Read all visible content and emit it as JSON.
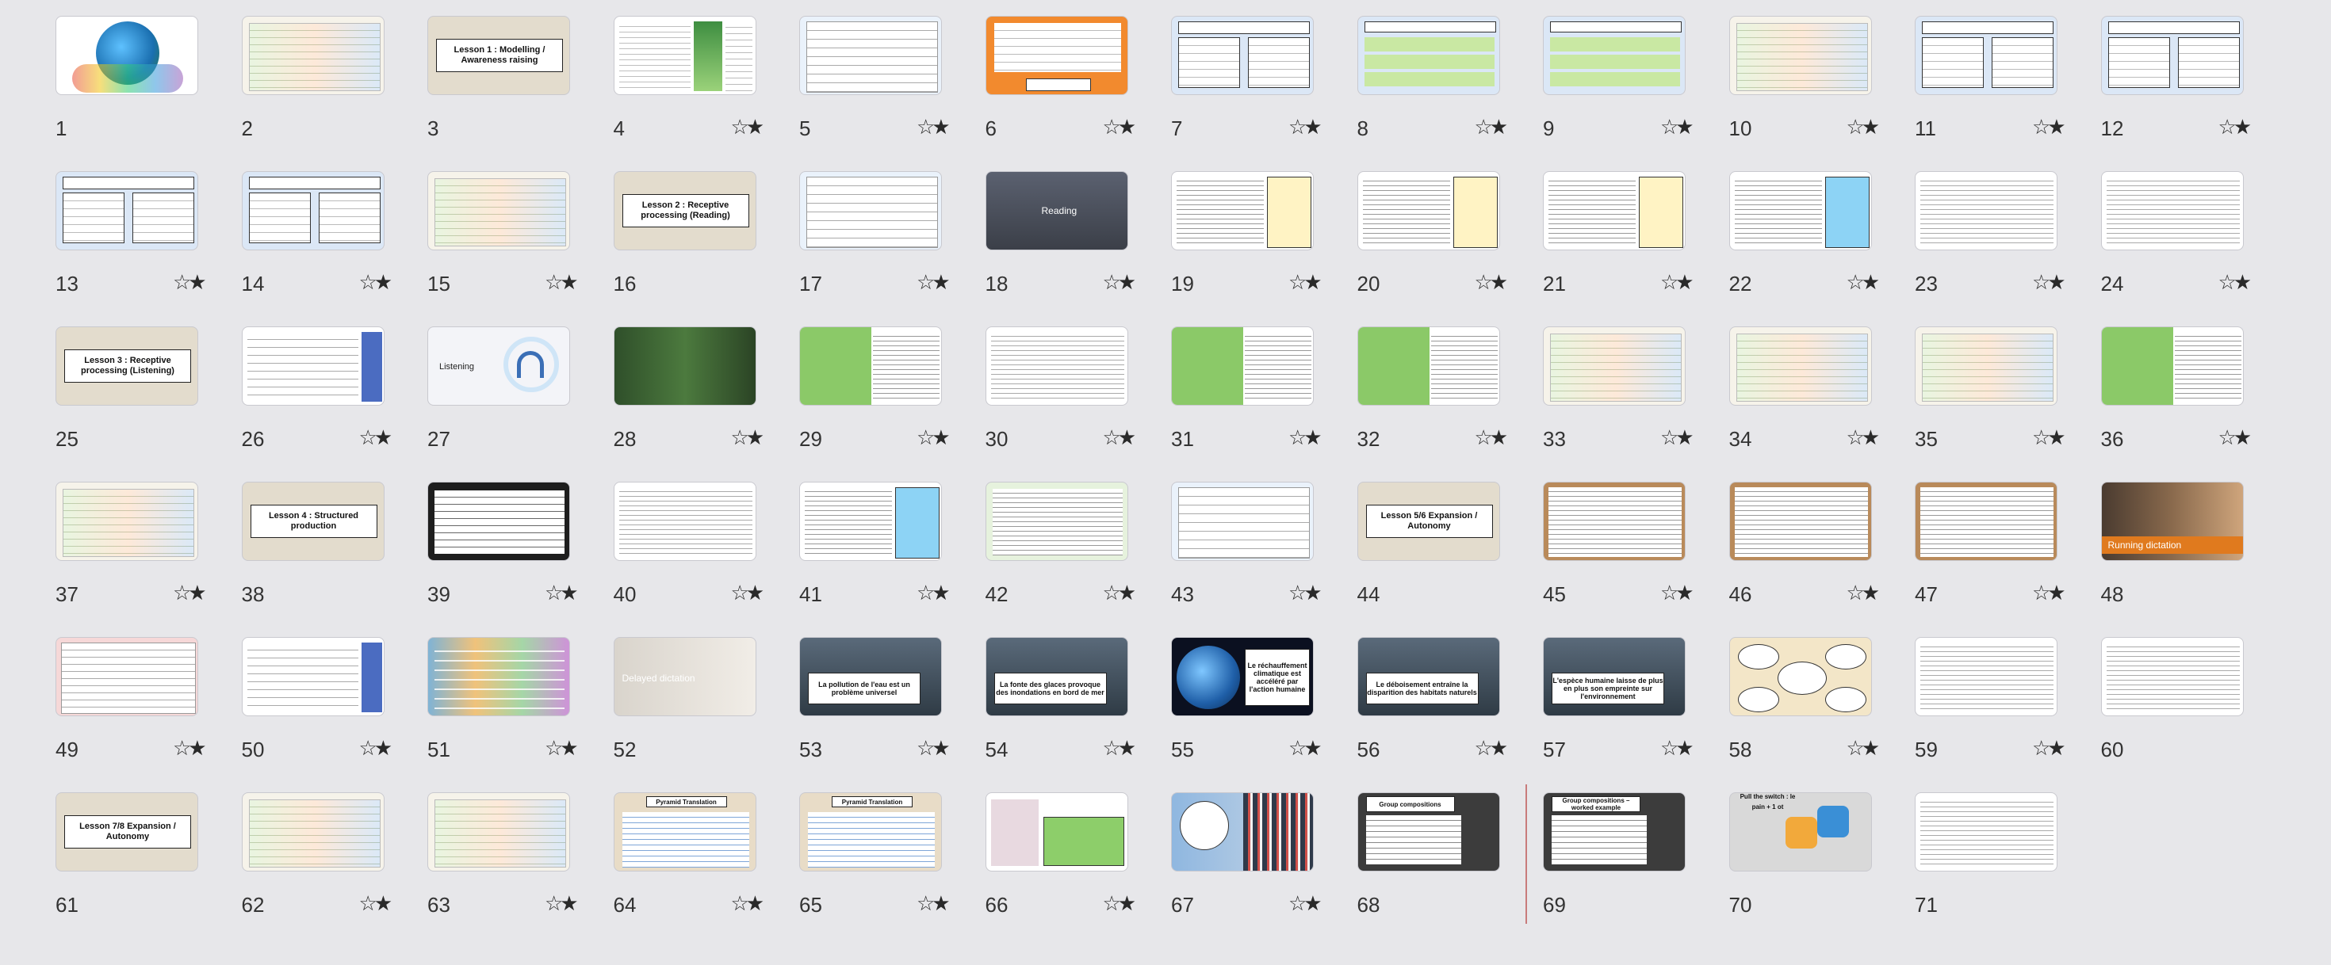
{
  "star_glyph": "☆★",
  "slides": [
    {
      "n": "1",
      "style": "globe"
    },
    {
      "n": "2",
      "style": "table"
    },
    {
      "n": "3",
      "style": "title-beige",
      "title": "Lesson 1 : Modelling / Awareness raising"
    },
    {
      "n": "4",
      "style": "list-img"
    },
    {
      "n": "5",
      "style": "list"
    },
    {
      "n": "6",
      "style": "orange"
    },
    {
      "n": "7",
      "style": "blue-q"
    },
    {
      "n": "8",
      "style": "green-q"
    },
    {
      "n": "9",
      "style": "green-q"
    },
    {
      "n": "10",
      "style": "table"
    },
    {
      "n": "11",
      "style": "blue-q"
    },
    {
      "n": "12",
      "style": "blue-q"
    },
    {
      "n": "13",
      "style": "blue-q"
    },
    {
      "n": "14",
      "style": "blue-q"
    },
    {
      "n": "15",
      "style": "table"
    },
    {
      "n": "16",
      "style": "title-beige",
      "title": "Lesson 2 : Receptive processing (Reading)"
    },
    {
      "n": "17",
      "style": "list"
    },
    {
      "n": "18",
      "style": "dark",
      "label": "Reading"
    },
    {
      "n": "19",
      "style": "text-yellow"
    },
    {
      "n": "20",
      "style": "text-yellow"
    },
    {
      "n": "21",
      "style": "text-yellow"
    },
    {
      "n": "22",
      "style": "text-blue"
    },
    {
      "n": "23",
      "style": "text"
    },
    {
      "n": "24",
      "style": "text"
    },
    {
      "n": "25",
      "style": "title-beige",
      "title": "Lesson 3 : Receptive processing (Listening)"
    },
    {
      "n": "26",
      "style": "list-blue"
    },
    {
      "n": "27",
      "style": "headphones",
      "label": "Listening"
    },
    {
      "n": "28",
      "style": "forest"
    },
    {
      "n": "29",
      "style": "green-text"
    },
    {
      "n": "30",
      "style": "text"
    },
    {
      "n": "31",
      "style": "green-text"
    },
    {
      "n": "32",
      "style": "green-text"
    },
    {
      "n": "33",
      "style": "table"
    },
    {
      "n": "34",
      "style": "table"
    },
    {
      "n": "35",
      "style": "table"
    },
    {
      "n": "36",
      "style": "green-text"
    },
    {
      "n": "37",
      "style": "table"
    },
    {
      "n": "38",
      "style": "title-beige",
      "title": "Lesson 4 : Structured production"
    },
    {
      "n": "39",
      "style": "dark-list"
    },
    {
      "n": "40",
      "style": "text"
    },
    {
      "n": "41",
      "style": "text-blue"
    },
    {
      "n": "42",
      "style": "text-green"
    },
    {
      "n": "43",
      "style": "list"
    },
    {
      "n": "44",
      "style": "title-beige",
      "title": "Lesson 5/6 Expansion / Autonomy"
    },
    {
      "n": "45",
      "style": "brown-text"
    },
    {
      "n": "46",
      "style": "brown-text"
    },
    {
      "n": "47",
      "style": "brown-text"
    },
    {
      "n": "48",
      "style": "running",
      "label": "Running dictation"
    },
    {
      "n": "49",
      "style": "red-list"
    },
    {
      "n": "50",
      "style": "list-blue"
    },
    {
      "n": "51",
      "style": "books"
    },
    {
      "n": "52",
      "style": "hourglass",
      "label": "Delayed dictation"
    },
    {
      "n": "53",
      "style": "photo-title",
      "title": "La pollution de l'eau est un problème universel"
    },
    {
      "n": "54",
      "style": "photo-title",
      "title": "La fonte des glaces provoque des inondations en bord de mer"
    },
    {
      "n": "55",
      "style": "earth",
      "title": "Le réchauffement climatique est accéléré par l'action humaine"
    },
    {
      "n": "56",
      "style": "photo-title",
      "title": "Le déboisement entraîne la disparition des habitats naturels"
    },
    {
      "n": "57",
      "style": "photo-title",
      "title": "L'espèce humaine laisse de plus en plus son empreinte sur l'environnement"
    },
    {
      "n": "58",
      "style": "bubbles"
    },
    {
      "n": "59",
      "style": "text"
    },
    {
      "n": "60",
      "style": "text"
    },
    {
      "n": "61",
      "style": "title-beige",
      "title": "Lesson 7/8 Expansion / Autonomy"
    },
    {
      "n": "62",
      "style": "table"
    },
    {
      "n": "63",
      "style": "table"
    },
    {
      "n": "64",
      "style": "pyramid",
      "title": "Pyramid Translation"
    },
    {
      "n": "65",
      "style": "pyramid",
      "title": "Pyramid Translation"
    },
    {
      "n": "66",
      "style": "map-green"
    },
    {
      "n": "67",
      "style": "blue-books"
    },
    {
      "n": "68",
      "style": "group",
      "title": "Group compositions"
    },
    {
      "n": "69",
      "style": "group",
      "title": "Group compositions – worked example"
    },
    {
      "n": "70",
      "style": "pull",
      "title": "Pull the switch : le pain + 1 ot"
    },
    {
      "n": "71",
      "style": "text"
    }
  ]
}
